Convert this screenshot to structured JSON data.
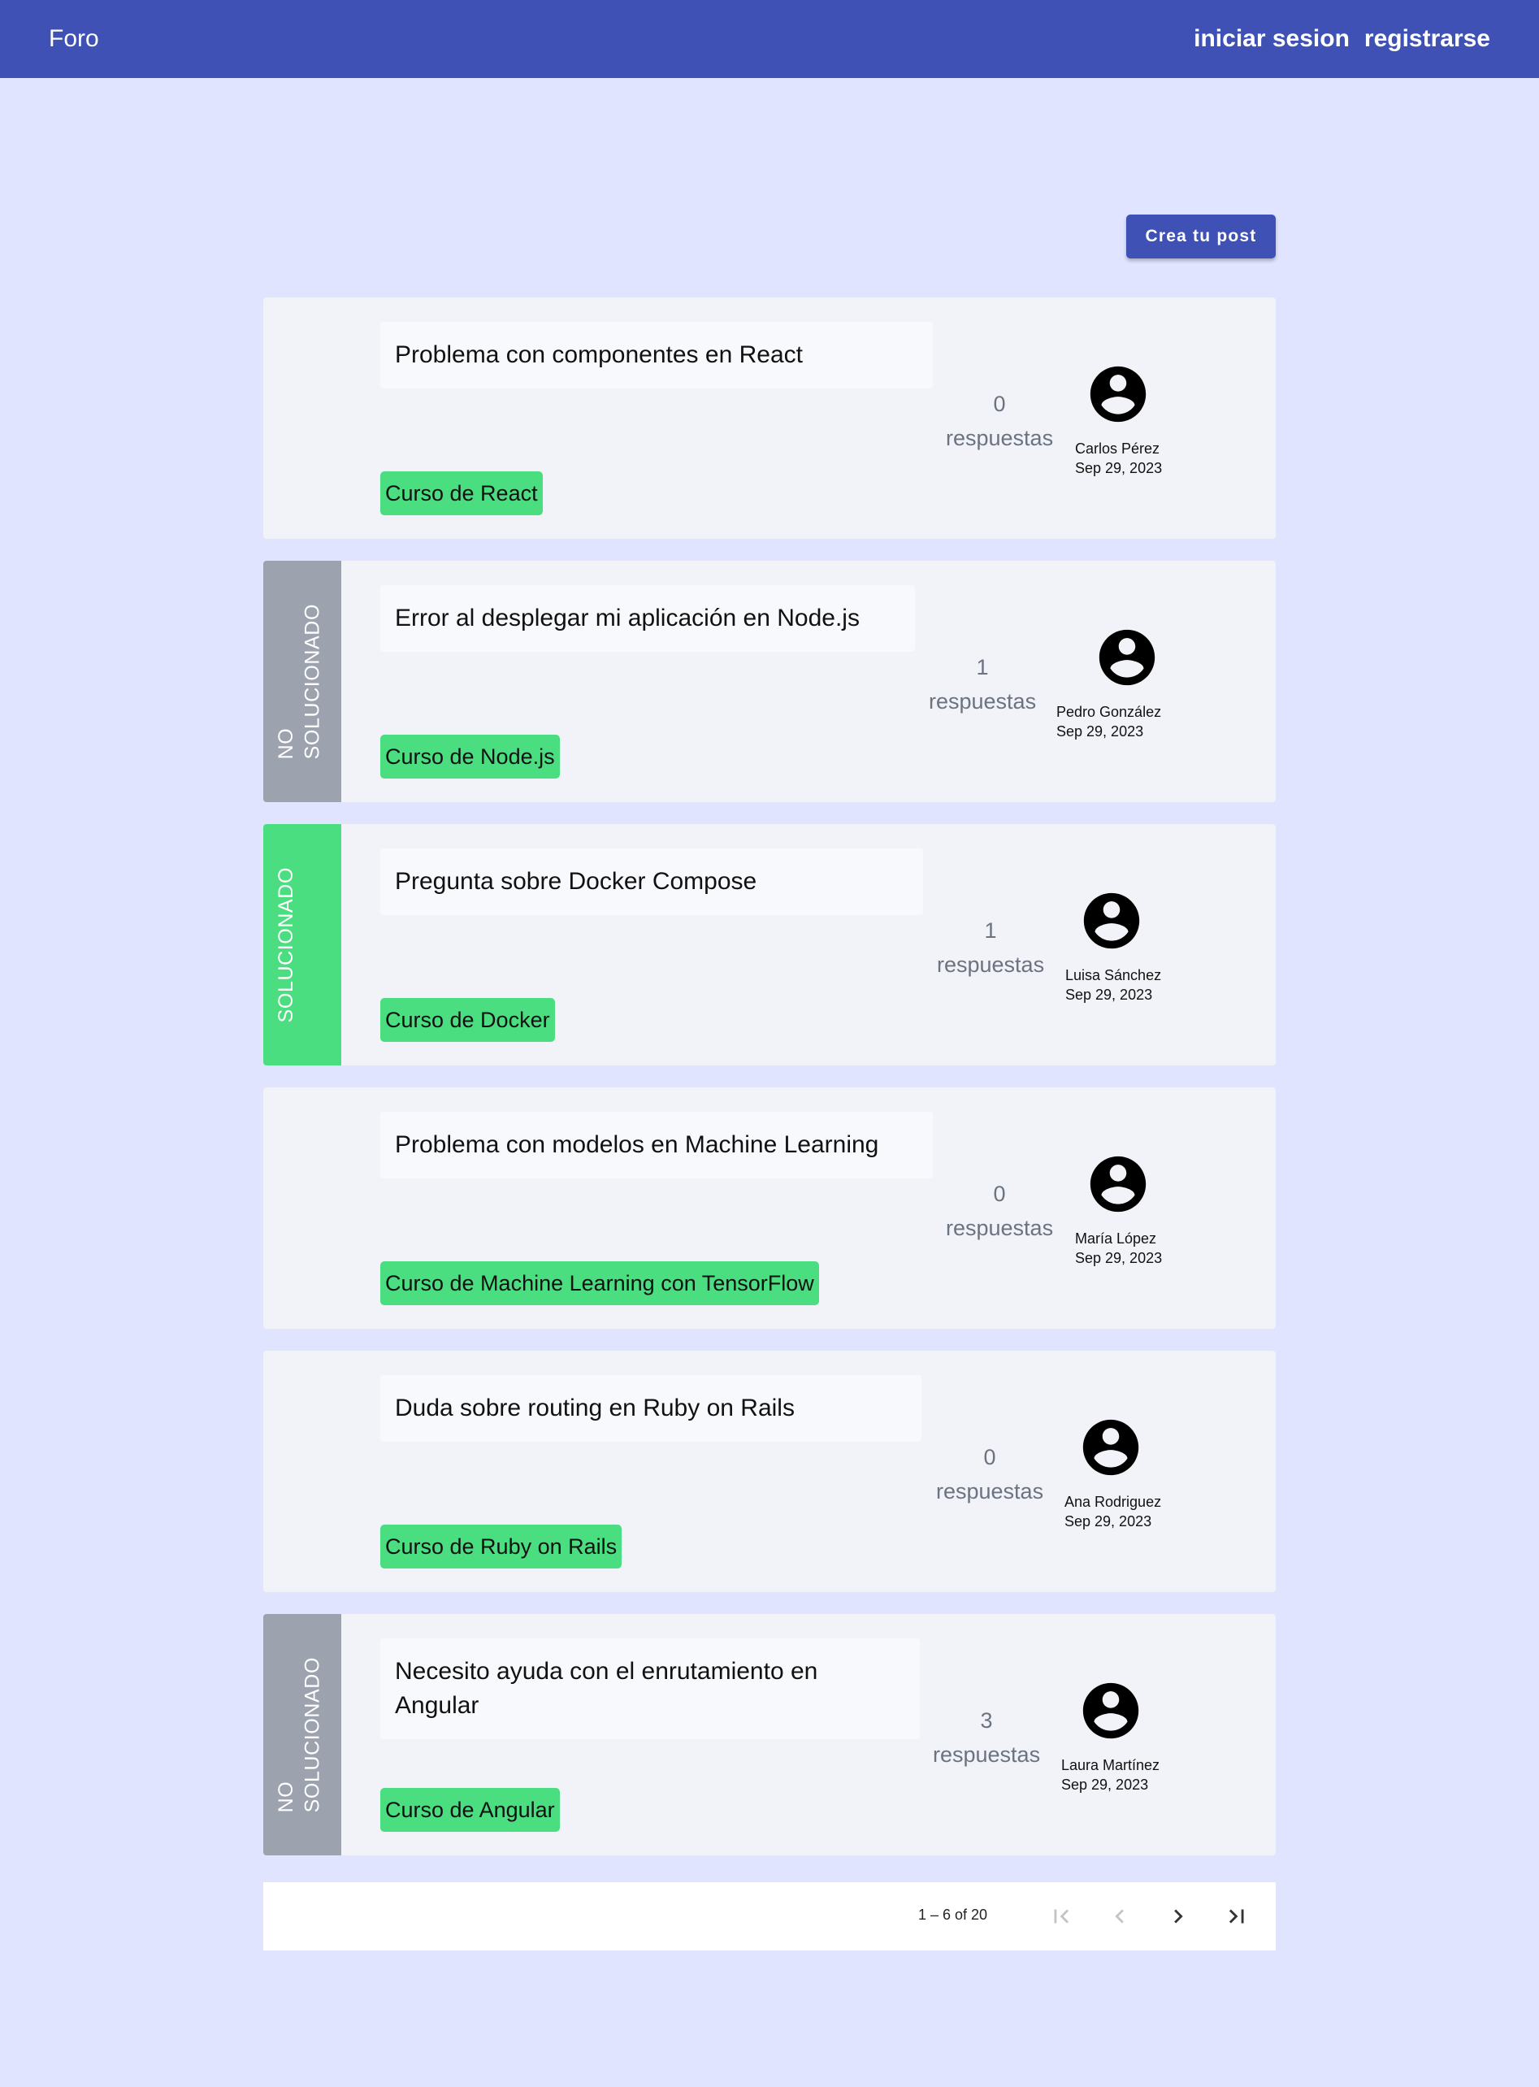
{
  "toolbar": {
    "brand": "Foro",
    "login_label": "iniciar sesion",
    "register_label": "registrarse",
    "color": "#3f51b5"
  },
  "create_post_label": "Crea tu post",
  "posts": [
    {
      "status": "",
      "title": "Problema con componentes en React",
      "course": "Curso de React",
      "replies_count": "0",
      "replies_label": "respuestas",
      "author": "Carlos Pérez",
      "date": "Sep 29, 2023"
    },
    {
      "status": "NO\nSOLUCIONADO",
      "title": "Error al desplegar mi aplicación en Node.js",
      "course": "Curso de Node.js",
      "replies_count": "1",
      "replies_label": "respuestas",
      "author": "Pedro González",
      "date": "Sep 29, 2023"
    },
    {
      "status": "SOLUCIONADO",
      "title": "Pregunta sobre Docker Compose",
      "course": "Curso de Docker",
      "replies_count": "1",
      "replies_label": "respuestas",
      "author": "Luisa Sánchez",
      "date": "Sep 29, 2023"
    },
    {
      "status": "",
      "title": "Problema con modelos en Machine Learning",
      "course": "Curso de Machine Learning con TensorFlow",
      "replies_count": "0",
      "replies_label": "respuestas",
      "author": "María López",
      "date": "Sep 29, 2023"
    },
    {
      "status": "",
      "title": "Duda sobre routing en Ruby on Rails",
      "course": "Curso de Ruby on Rails",
      "replies_count": "0",
      "replies_label": "respuestas",
      "author": "Ana Rodriguez",
      "date": "Sep 29, 2023"
    },
    {
      "status": "NO\nSOLUCIONADO",
      "title": "Necesito ayuda con el enrutamiento en\nAngular",
      "course": "Curso de Angular",
      "replies_count": "3",
      "replies_label": "respuestas",
      "author": "Laura Martínez",
      "date": "Sep 29, 2023"
    }
  ],
  "status_colors": {
    "solved": "#4ade80",
    "unsolved": "#9ca2ae",
    "tag": "#4ade80"
  },
  "paginator": {
    "range_label": "1 – 6 of 20",
    "first_icon": "first-page-icon",
    "prev_icon": "chevron-left-icon",
    "next_icon": "chevron-right-icon",
    "last_icon": "last-page-icon"
  }
}
